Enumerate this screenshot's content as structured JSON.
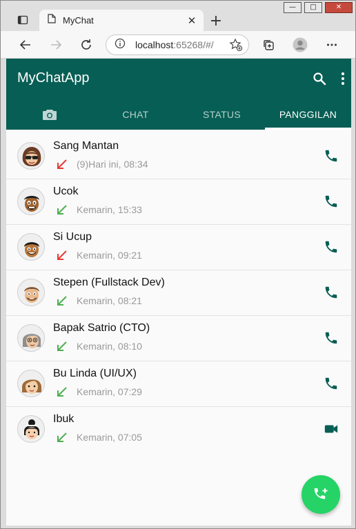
{
  "browser": {
    "tab_title": "MyChat",
    "address_host": "localhost",
    "address_path": ":65268/#/",
    "icons": [
      "tab-actions-icon",
      "page-icon",
      "close-icon",
      "new-tab-icon",
      "back-icon",
      "forward-icon",
      "refresh-icon",
      "info-icon",
      "favorite-icon",
      "collections-icon",
      "profile-icon",
      "more-icon"
    ]
  },
  "app": {
    "title": "MyChatApp",
    "tabs": [
      "CHAT",
      "STATUS",
      "PANGGILAN"
    ],
    "active_tab": "PANGGILAN",
    "colors": {
      "primary": "#075e54",
      "accent": "#25d366",
      "missed": "#e53935",
      "received": "#4caf50"
    }
  },
  "calls": [
    {
      "name": "Sang Mantan",
      "time": "(9)Hari ini, 08:34",
      "direction": "missed",
      "type": "voice"
    },
    {
      "name": "Ucok",
      "time": "Kemarin, 15:33",
      "direction": "incoming",
      "type": "voice"
    },
    {
      "name": "Si Ucup",
      "time": "Kemarin, 09:21",
      "direction": "missed",
      "type": "voice"
    },
    {
      "name": "Stepen (Fullstack Dev)",
      "time": "Kemarin, 08:21",
      "direction": "incoming",
      "type": "voice"
    },
    {
      "name": "Bapak Satrio (CTO)",
      "time": "Kemarin, 08:10",
      "direction": "incoming",
      "type": "voice"
    },
    {
      "name": "Bu Linda (UI/UX)",
      "time": "Kemarin, 07:29",
      "direction": "incoming",
      "type": "voice"
    },
    {
      "name": "Ibuk",
      "time": "Kemarin, 07:05",
      "direction": "incoming",
      "type": "video"
    }
  ]
}
